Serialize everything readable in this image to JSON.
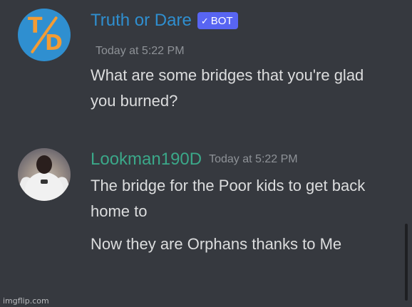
{
  "messages": [
    {
      "author": "Truth or Dare",
      "badge": "BOT",
      "badge_check": "✓",
      "timestamp": "Today at 5:22 PM",
      "lines": [
        "What are some bridges that you're glad you burned?"
      ],
      "avatar": "truth-or-dare-logo",
      "name_color": "#2f8fd0"
    },
    {
      "author": "Lookman190D",
      "timestamp": "Today at 5:22 PM",
      "lines": [
        "The bridge for the Poor kids to get back home to",
        "Now they are Orphans thanks to Me"
      ],
      "avatar": "user-photo",
      "name_color": "#3ba889"
    }
  ],
  "avatar_text": {
    "t": "T",
    "d": "D"
  },
  "watermark": "imgflip.com",
  "colors": {
    "background": "#36393f",
    "text": "#dcddde",
    "timestamp": "#8e9297",
    "badge": "#5865f2"
  }
}
